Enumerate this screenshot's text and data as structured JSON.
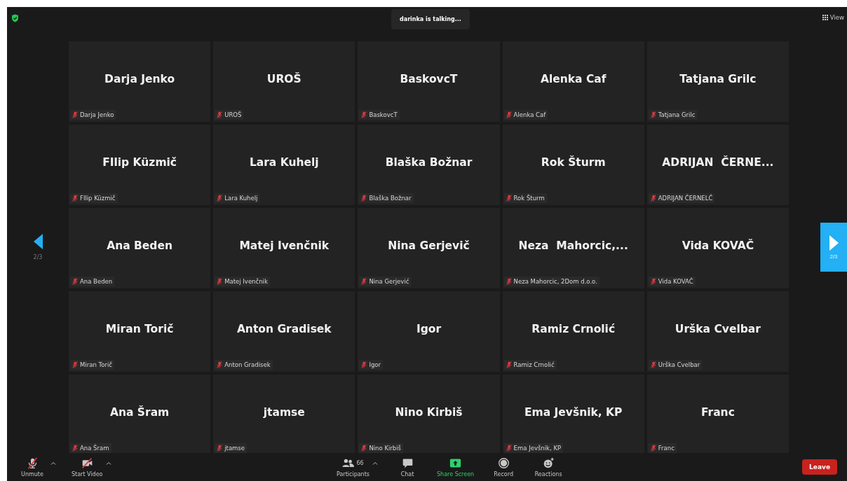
{
  "top_bar": {
    "talking_banner": "darinka is talking...",
    "view_button": "View"
  },
  "pager": {
    "previous": "2/3",
    "next": "2/3"
  },
  "tiles": [
    {
      "name": "Darja Jenko",
      "tag": "Darja Jenko",
      "muted": true
    },
    {
      "name": "UROŠ",
      "tag": "UROŠ",
      "muted": true
    },
    {
      "name": "BaskovcT",
      "tag": "BaskovcT",
      "muted": true
    },
    {
      "name": "Alenka Caf",
      "tag": "Alenka Caf",
      "muted": true
    },
    {
      "name": "Tatjana Grilc",
      "tag": "Tatjana Grilc",
      "muted": true
    },
    {
      "name": "FIlip Küzmič",
      "tag": "FIlip Küzmič",
      "muted": true
    },
    {
      "name": "Lara Kuhelj",
      "tag": "Lara Kuhelj",
      "muted": true
    },
    {
      "name": "Blaška Božnar",
      "tag": "Blaška Božnar",
      "muted": true
    },
    {
      "name": "Rok Šturm",
      "tag": "Rok Šturm",
      "muted": true
    },
    {
      "name": "ADRIJAN  ČERNE...",
      "tag": "ADRIJAN ČERNELČ",
      "muted": true
    },
    {
      "name": "Ana Beden",
      "tag": "Ana Beden",
      "muted": true
    },
    {
      "name": "Matej Ivenčnik",
      "tag": "Matej Ivenčnik",
      "muted": true
    },
    {
      "name": "Nina Gerjevič",
      "tag": "Nina Gerjević",
      "muted": true
    },
    {
      "name": "Neza  Mahorcic,...",
      "tag": "Neza Mahorcic, 2Dom d.o.o.",
      "muted": true
    },
    {
      "name": "Vida KOVAČ",
      "tag": "Vida KOVAČ",
      "muted": true
    },
    {
      "name": "Miran Torič",
      "tag": "Miran Torič",
      "muted": true
    },
    {
      "name": "Anton Gradisek",
      "tag": "Anton Gradisek",
      "muted": true
    },
    {
      "name": "Igor",
      "tag": "Igor",
      "muted": true
    },
    {
      "name": "Ramiz Crnolić",
      "tag": "Ramiz Crnolić",
      "muted": true
    },
    {
      "name": "Urška Cvelbar",
      "tag": "Urška Cvelbar",
      "muted": true
    },
    {
      "name": "Ana Šram",
      "tag": "Ana Šram",
      "muted": true
    },
    {
      "name": "jtamse",
      "tag": "jtamse",
      "muted": true
    },
    {
      "name": "Nino Kirbiš",
      "tag": "Nino Kirbiš",
      "muted": true
    },
    {
      "name": "Ema Jevšnik, KP",
      "tag": "Ema Jevšnik, KP",
      "muted": true
    },
    {
      "name": "Franc",
      "tag": "Franc",
      "muted": true
    }
  ],
  "toolbar": {
    "left": [
      {
        "kind": "mic-off",
        "label": "Unmute"
      },
      {
        "kind": "video-off",
        "label": "Start Video"
      }
    ],
    "center": [
      {
        "kind": "participants",
        "label": "Participants",
        "count": "66",
        "highlighted": false
      },
      {
        "kind": "chat",
        "label": "Chat",
        "highlighted": false
      },
      {
        "kind": "share",
        "label": "Share Screen",
        "highlighted": true
      },
      {
        "kind": "record",
        "label": "Record",
        "highlighted": false
      },
      {
        "kind": "reactions",
        "label": "Reactions",
        "highlighted": false
      }
    ],
    "leave_button": "Leave"
  }
}
